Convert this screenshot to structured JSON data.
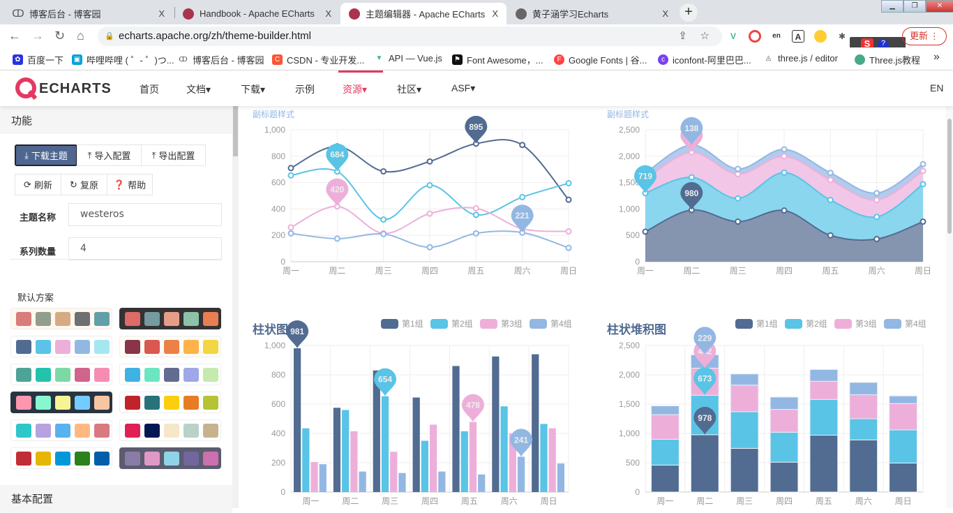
{
  "browser": {
    "tabs": [
      {
        "title": "博客后台 - 博客园",
        "icon": "cnblogs-icon",
        "color": "#555"
      },
      {
        "title": "Handbook - Apache ECharts",
        "icon": "echarts-icon",
        "color": "#aa344d"
      },
      {
        "title": "主题编辑器 - Apache ECharts",
        "icon": "echarts-icon",
        "color": "#aa344d",
        "active": true
      },
      {
        "title": "黄子涵学习Echarts",
        "icon": "globe-icon",
        "color": "#666"
      }
    ],
    "close_label": "X",
    "new_tab_label": "+",
    "url": "echarts.apache.org/zh/theme-builder.html",
    "update_label": "更新",
    "bookmarks": [
      {
        "label": "百度一下",
        "color": "#2932e1"
      },
      {
        "label": "哔哩哔哩 ( ゜- ゜)つ...",
        "color": "#00a1d6"
      },
      {
        "label": "博客后台 - 博客园",
        "color": "#555"
      },
      {
        "label": "CSDN - 专业开发...",
        "color": "#fc5531"
      },
      {
        "label": "API — Vue.js",
        "color": "#41b883"
      },
      {
        "label": "Font Awesome，...",
        "color": "#111"
      },
      {
        "label": "Google Fonts | 谷...",
        "color": "#f44"
      },
      {
        "label": "iconfont-阿里巴巴...",
        "color": "#7b3ff2"
      },
      {
        "label": "three.js / editor",
        "color": "#888"
      },
      {
        "label": "Three.js教程",
        "color": "#4a8"
      }
    ],
    "more_label": "»"
  },
  "nav": {
    "logo": "ECHARTS",
    "items": [
      {
        "label": "首页"
      },
      {
        "label": "文档▾"
      },
      {
        "label": "下载▾"
      },
      {
        "label": "示例"
      },
      {
        "label": "资源▾",
        "active": true
      },
      {
        "label": "社区▾"
      },
      {
        "label": "ASF▾"
      }
    ],
    "lang": "EN",
    "accent": "#e43961"
  },
  "sidebar": {
    "section_function": "功能",
    "buttons": {
      "download": "下载主题",
      "import": "导入配置",
      "export": "导出配置",
      "refresh": "刷新",
      "reset": "复原",
      "help": "帮助"
    },
    "theme_name_label": "主题名称",
    "theme_name_value": "westeros",
    "series_count_label": "系列数量",
    "series_count_value": "4",
    "presets_label": "默认方案",
    "palettes": [
      {
        "bg": "#fef8ef",
        "colors": [
          "#d87c7c",
          "#919e8b",
          "#d7ab82",
          "#6e7074",
          "#61a0a8"
        ]
      },
      {
        "bg": "#333333",
        "colors": [
          "#dd6b66",
          "#759aa0",
          "#e69d87",
          "#8dc1a9",
          "#ea7e53"
        ]
      },
      {
        "bg": "#ffffff",
        "colors": [
          "#516b91",
          "#59c4e6",
          "#edafda",
          "#93b7e3",
          "#a5e7f0"
        ]
      },
      {
        "bg": "#fdfcf5",
        "colors": [
          "#893448",
          "#d95850",
          "#eb8146",
          "#ffb248",
          "#f2d643"
        ]
      },
      {
        "bg": "#ffffff",
        "colors": [
          "#4ea397",
          "#22c3aa",
          "#7bd9a5",
          "#d0648a",
          "#f58db2"
        ]
      },
      {
        "bg": "#ffffff",
        "colors": [
          "#3fb1e3",
          "#6be6c1",
          "#626c91",
          "#a0a7e6",
          "#c4ebad"
        ]
      },
      {
        "bg": "#293441",
        "colors": [
          "#fc97af",
          "#87f7cf",
          "#f7f494",
          "#72ccff",
          "#f7c5a0"
        ]
      },
      {
        "bg": "#ffffff",
        "colors": [
          "#c1232b",
          "#27727b",
          "#fcce10",
          "#e87c25",
          "#b5c334"
        ]
      },
      {
        "bg": "#ffffff",
        "colors": [
          "#2ec7c9",
          "#b6a2de",
          "#5ab1ef",
          "#ffb980",
          "#d87a80"
        ]
      },
      {
        "bg": "#ffffff",
        "colors": [
          "#e01f54",
          "#001852",
          "#f5e8c8",
          "#b8d2c7",
          "#c6b38e"
        ]
      },
      {
        "bg": "#ffffff",
        "colors": [
          "#c12e34",
          "#e6b600",
          "#0098d9",
          "#2b821d",
          "#005eaa"
        ]
      },
      {
        "bg": "#5b5c6e",
        "colors": [
          "#8a7ca8",
          "#e098c7",
          "#8fd3e8",
          "#71669e",
          "#cc70af"
        ]
      }
    ],
    "section_basic": "基本配置"
  },
  "chart_data": [
    {
      "type": "line",
      "subtitle": "副标题样式",
      "smooth": true,
      "categories": [
        "周一",
        "周二",
        "周三",
        "周四",
        "周五",
        "周六",
        "周日"
      ],
      "ylim": [
        0,
        1000
      ],
      "yticks": [
        "0",
        "200",
        "400",
        "600",
        "800",
        "1,000"
      ],
      "grid": true,
      "colors": [
        "#516b91",
        "#59c4e6",
        "#edafda",
        "#93b7e3"
      ],
      "series": [
        {
          "values": [
            710,
            875,
            685,
            760,
            895,
            885,
            470
          ],
          "max_label": "895"
        },
        {
          "values": [
            655,
            684,
            320,
            580,
            355,
            490,
            595
          ],
          "max_label": "684"
        },
        {
          "values": [
            260,
            420,
            215,
            365,
            405,
            250,
            230
          ],
          "max_label": "420"
        },
        {
          "values": [
            215,
            175,
            210,
            110,
            215,
            221,
            105
          ],
          "max_label": "221"
        }
      ]
    },
    {
      "type": "area",
      "stacked": true,
      "subtitle": "副标题样式",
      "smooth": true,
      "categories": [
        "周一",
        "周二",
        "周三",
        "周四",
        "周五",
        "周六",
        "周日"
      ],
      "ylim": [
        0,
        2500
      ],
      "yticks": [
        "0",
        "500",
        "1,000",
        "1,500",
        "2,000",
        "2,500"
      ],
      "grid": true,
      "colors": [
        "#516b91",
        "#59c4e6",
        "#edafda",
        "#93b7e3"
      ],
      "series": [
        {
          "values": [
            570,
            980,
            760,
            970,
            500,
            430,
            760
          ],
          "max_label": "980"
        },
        {
          "values": [
            730,
            620,
            440,
            719,
            670,
            420,
            710
          ],
          "max_label": "719"
        },
        {
          "values": [
            260,
            474,
            460,
            310,
            380,
            320,
            250
          ],
          "max_label": "474"
        },
        {
          "values": [
            120,
            138,
            100,
            130,
            135,
            130,
            130
          ],
          "max_label": "138"
        }
      ]
    },
    {
      "type": "bar",
      "title": "柱状图",
      "legend_position": "top-right",
      "categories": [
        "周一",
        "周二",
        "周三",
        "周四",
        "周五",
        "周六",
        "周日"
      ],
      "ylim": [
        0,
        1000
      ],
      "yticks": [
        "0",
        "200",
        "400",
        "600",
        "800",
        "1,000"
      ],
      "grid": true,
      "colors": [
        "#516b91",
        "#59c4e6",
        "#edafda",
        "#93b7e3"
      ],
      "series": [
        {
          "name": "第1组",
          "values": [
            981,
            575,
            830,
            645,
            860,
            925,
            940
          ],
          "max_label": "981"
        },
        {
          "name": "第2组",
          "values": [
            435,
            560,
            654,
            350,
            415,
            585,
            465
          ],
          "max_label": "654"
        },
        {
          "name": "第3组",
          "values": [
            205,
            415,
            275,
            460,
            478,
            400,
            435
          ],
          "max_label": "478"
        },
        {
          "name": "第4组",
          "values": [
            190,
            140,
            130,
            140,
            120,
            241,
            195
          ],
          "max_label": "241"
        }
      ]
    },
    {
      "type": "bar",
      "stacked": true,
      "title": "柱状堆积图",
      "legend_position": "top-right",
      "categories": [
        "周一",
        "周二",
        "周三",
        "周四",
        "周五",
        "周六",
        "周日"
      ],
      "ylim": [
        0,
        2500
      ],
      "yticks": [
        "0",
        "500",
        "1,000",
        "1,500",
        "2,000",
        "2,500"
      ],
      "grid": true,
      "colors": [
        "#516b91",
        "#59c4e6",
        "#edafda",
        "#93b7e3"
      ],
      "series": [
        {
          "name": "第1组",
          "values": [
            460,
            978,
            745,
            510,
            970,
            890,
            495
          ],
          "max_label": "978"
        },
        {
          "name": "第2组",
          "values": [
            440,
            673,
            625,
            510,
            610,
            360,
            565
          ],
          "max_label": "673"
        },
        {
          "name": "第3组",
          "values": [
            420,
            462,
            455,
            390,
            310,
            410,
            450
          ],
          "max_label": "462"
        },
        {
          "name": "第4组",
          "values": [
            150,
            229,
            190,
            210,
            200,
            210,
            130
          ],
          "max_label": "229"
        }
      ]
    }
  ]
}
